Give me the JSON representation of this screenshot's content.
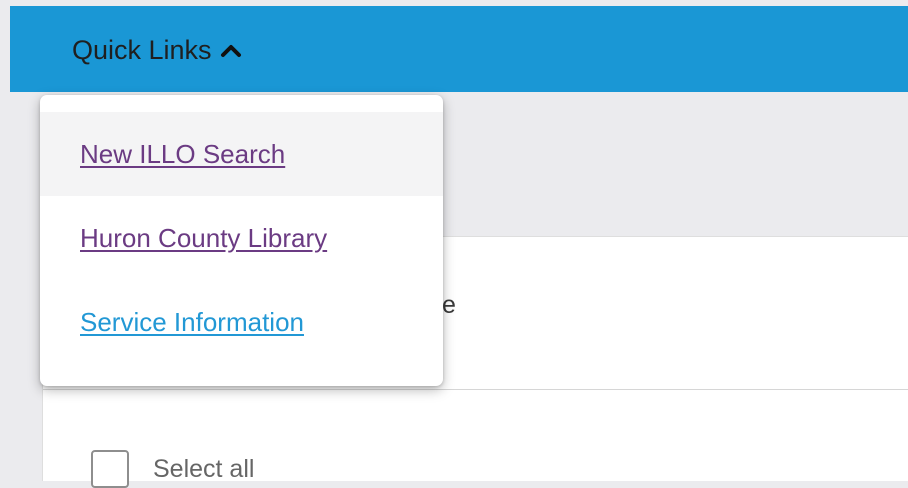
{
  "header": {
    "quick_links_label": "Quick Links",
    "toggle_icon": "chevron-up-icon",
    "background_color": "#1a97d5"
  },
  "dropdown": {
    "items": [
      {
        "label": "New ILLO Search",
        "state": "visited",
        "color": "#6b3b83"
      },
      {
        "label": "Huron County Library",
        "state": "visited",
        "color": "#6b3b83"
      },
      {
        "label": "Service Information",
        "state": "link",
        "color": "#2298d5"
      }
    ]
  },
  "content": {
    "profile_fragment": "file",
    "select_all_label": "Select all"
  }
}
